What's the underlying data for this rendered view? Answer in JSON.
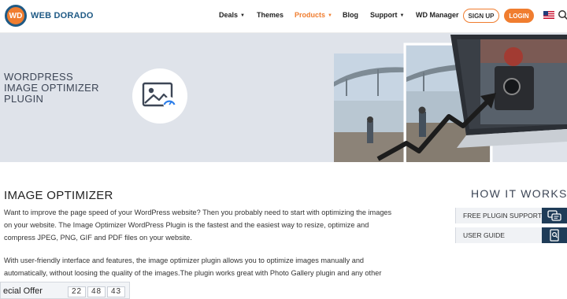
{
  "header": {
    "logo_initials": "WD",
    "logo_text": "WEB DORADO",
    "nav": [
      {
        "label": "Deals",
        "has_caret": true
      },
      {
        "label": "Themes",
        "has_caret": false
      },
      {
        "label": "Products",
        "has_caret": true,
        "active": true
      },
      {
        "label": "Blog",
        "has_caret": false
      },
      {
        "label": "Support",
        "has_caret": true
      },
      {
        "label": "WD Manager",
        "has_caret": false
      }
    ],
    "signup_label": "SIGN UP",
    "login_label": "LOGIN",
    "language_icon": "us-flag-icon",
    "search_icon": "search-icon"
  },
  "hero": {
    "title_lines": [
      "WORDPRESS",
      "IMAGE OPTIMIZER",
      "PLUGIN"
    ],
    "icon": "image-optimize-icon"
  },
  "main": {
    "heading": "IMAGE OPTIMIZER",
    "paragraph1": "Want to improve the page speed of your WordPress website? Then you probably need to start with optimizing the images on your website. The Image Optimizer WordPress Plugin is the fastest and the easiest way to resize, optimize and compress JPEG, PNG, GIF and PDF files on your website.",
    "paragraph2": "With user-friendly interface and features, the image optimizer plugin allows you to optimize images manually and automatically, without loosing the quality of the images.The plugin works great with Photo Gallery plugin and any other"
  },
  "sidebar": {
    "title": "HOW IT WORKS",
    "buttons": [
      {
        "label": "FREE PLUGIN SUPPORT",
        "icon": "chat-icon"
      },
      {
        "label": "USER GUIDE",
        "icon": "guide-icon"
      }
    ]
  },
  "offer": {
    "label": "ecial Offer",
    "timer": [
      "22",
      "48",
      "43"
    ]
  },
  "colors": {
    "accent": "#f07d2f",
    "brand_blue": "#1f5a85",
    "hero_bg": "#dfe3ea",
    "dark_navy": "#1f3c58"
  }
}
